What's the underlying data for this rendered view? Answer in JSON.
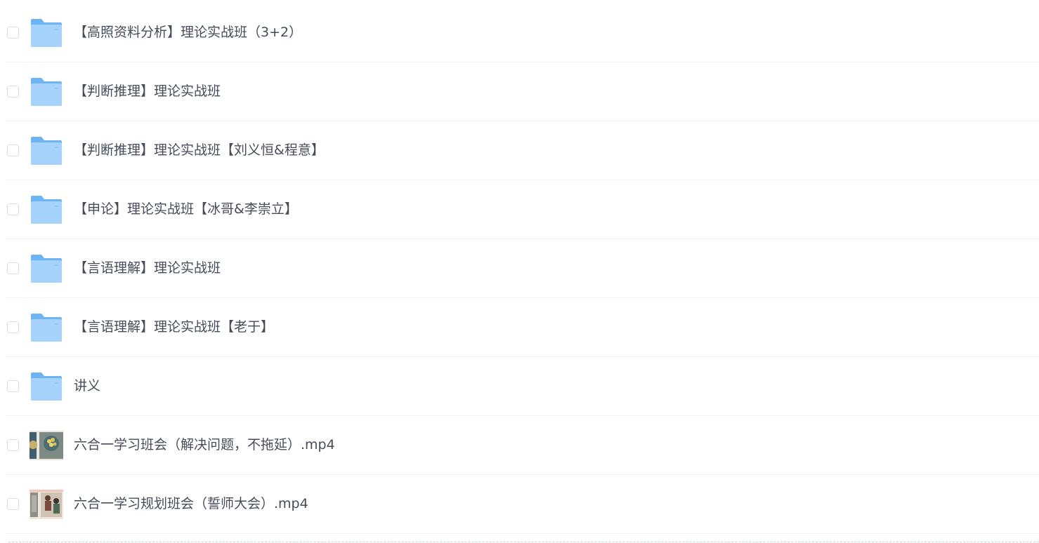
{
  "files": [
    {
      "name": "【高照资料分析】理论实战班（3+2）",
      "icon": "folder-icon",
      "type": "folder"
    },
    {
      "name": "【判断推理】理论实战班",
      "icon": "folder-icon",
      "type": "folder"
    },
    {
      "name": "【判断推理】理论实战班【刘义恒&程意】",
      "icon": "folder-icon",
      "type": "folder"
    },
    {
      "name": "【申论】理论实战班【冰哥&李崇立】",
      "icon": "folder-icon",
      "type": "folder"
    },
    {
      "name": "【言语理解】理论实战班",
      "icon": "folder-icon",
      "type": "folder"
    },
    {
      "name": "【言语理解】理论实战班【老于】",
      "icon": "folder-icon",
      "type": "folder"
    },
    {
      "name": "讲义",
      "icon": "folder-icon",
      "type": "folder"
    },
    {
      "name": "六合一学习班会（解决问题，不拖延）.mp4",
      "icon": "video-thumbnail",
      "type": "video"
    },
    {
      "name": "六合一学习规划班会（誓师大会）.mp4",
      "icon": "video-thumbnail",
      "type": "video"
    }
  ],
  "colors": {
    "folder_light": "#9fd0fb",
    "folder_dark": "#6db4f5",
    "text": "#454d5a",
    "divider": "#f1f2f4"
  }
}
